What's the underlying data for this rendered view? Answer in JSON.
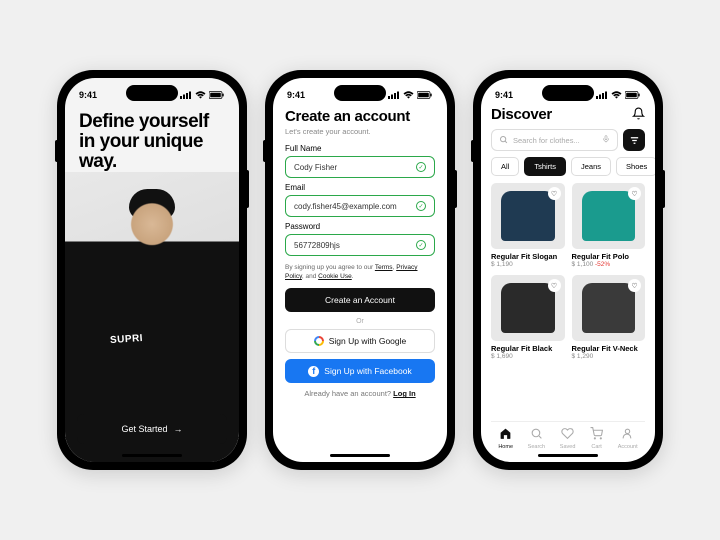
{
  "status": {
    "time": "9:41"
  },
  "phone1": {
    "headline": "Define yourself in your unique way.",
    "supreme": "SUPRI",
    "cta": "Get Started"
  },
  "phone2": {
    "title": "Create an account",
    "subtitle": "Let's create your account.",
    "fields": {
      "name_label": "Full Name",
      "name_value": "Cody Fisher",
      "email_label": "Email",
      "email_value": "cody.fisher45@example.com",
      "password_label": "Password",
      "password_value": "56772809hjs"
    },
    "terms_prefix": "By signing up you agree to our ",
    "terms": "Terms",
    "privacy": "Privacy Policy",
    "cookie": "Cookie Use",
    "and": " and ",
    "comma": ", ",
    "create_btn": "Create an Account",
    "or": "Or",
    "google_btn": "Sign Up with Google",
    "fb_btn": "Sign Up with Facebook",
    "login_prefix": "Already have an account? ",
    "login": "Log In"
  },
  "phone3": {
    "title": "Discover",
    "search_placeholder": "Search for clothes...",
    "categories": {
      "all": "All",
      "tshirts": "Tshirts",
      "jeans": "Jeans",
      "shoes": "Shoes"
    },
    "products": [
      {
        "name": "Regular Fit Slogan",
        "price": "$ 1,190"
      },
      {
        "name": "Regular Fit Polo",
        "price": "$ 1,100",
        "discount": "-52%"
      },
      {
        "name": "Regular Fit Black",
        "price": "$ 1,690"
      },
      {
        "name": "Regular Fit V-Neck",
        "price": "$ 1,290"
      }
    ],
    "tabs": {
      "home": "Home",
      "search": "Search",
      "saved": "Saved",
      "cart": "Cart",
      "account": "Account"
    }
  }
}
